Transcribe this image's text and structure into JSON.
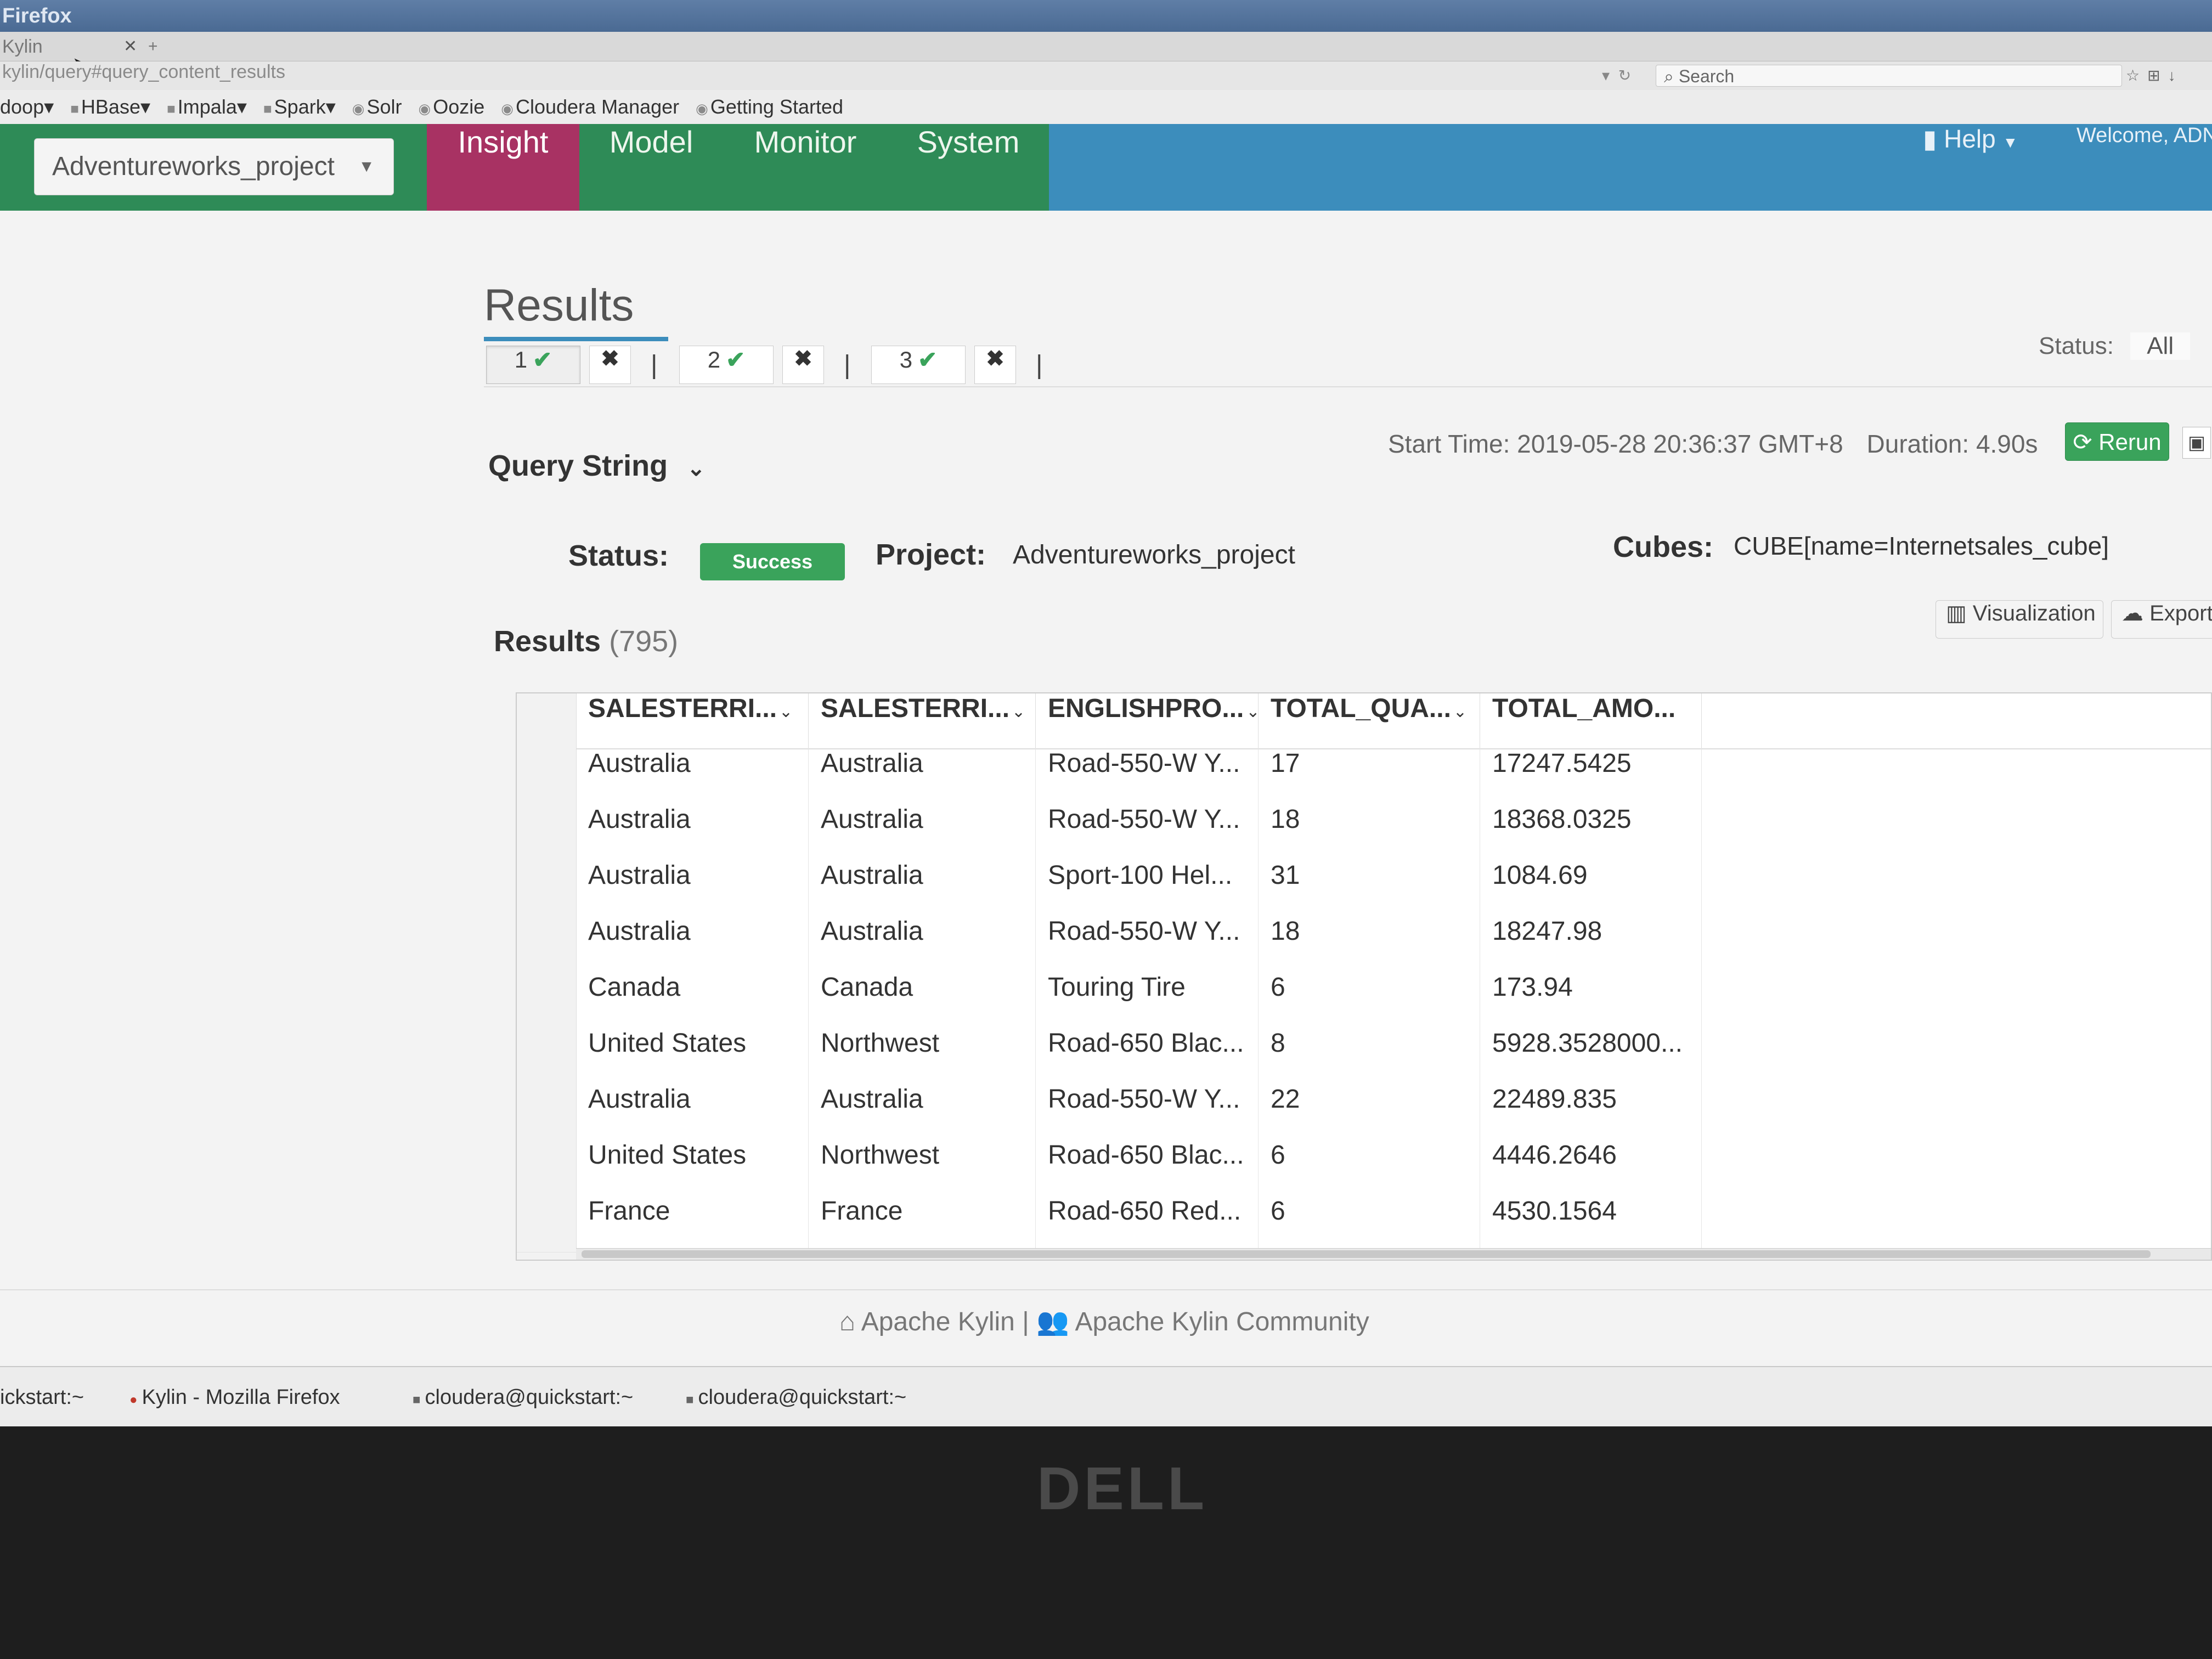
{
  "browser": {
    "window_title": "Firefox",
    "tab_title": "Kylin",
    "url": "kylin/query#query_content_results",
    "search_placeholder": "Search",
    "bookmarks": [
      "doop",
      "HBase",
      "Impala",
      "Spark",
      "Solr",
      "Oozie",
      "Cloudera Manager",
      "Getting Started"
    ]
  },
  "nav": {
    "project": "Adventureworks_project",
    "tabs": [
      "Insight",
      "Model",
      "Monitor",
      "System"
    ],
    "active_tab": "Insight",
    "help": "Help",
    "welcome": "Welcome, ADN"
  },
  "results": {
    "title": "Results",
    "query_tabs": [
      "1",
      "2",
      "3"
    ],
    "status_filter_label": "Status:",
    "status_filter_value": "All",
    "query_string_label": "Query String",
    "start_time": "Start Time: 2019-05-28 20:36:37 GMT+8",
    "duration": "Duration: 4.90s",
    "rerun": "Rerun",
    "status_label": "Status:",
    "status_value": "Success",
    "project_label": "Project:",
    "project_value": "Adventureworks_project",
    "cubes_label": "Cubes:",
    "cubes_value": "CUBE[name=Internetsales_cube]",
    "results_label": "Results",
    "results_count": "(795)",
    "visualization": "Visualization",
    "export": "Export"
  },
  "table": {
    "columns": [
      "SALESTERRI...",
      "SALESTERRI...",
      "ENGLISHPRO...",
      "TOTAL_QUA...",
      "TOTAL_AMO..."
    ],
    "rows": [
      [
        "Australia",
        "Australia",
        "Road-550-W Y...",
        "17",
        "17247.5425"
      ],
      [
        "Australia",
        "Australia",
        "Road-550-W Y...",
        "18",
        "18368.0325"
      ],
      [
        "Australia",
        "Australia",
        "Sport-100 Hel...",
        "31",
        "1084.69"
      ],
      [
        "Australia",
        "Australia",
        "Road-550-W Y...",
        "18",
        "18247.98"
      ],
      [
        "Canada",
        "Canada",
        "Touring Tire",
        "6",
        "173.94"
      ],
      [
        "United States",
        "Northwest",
        "Road-650 Blac...",
        "8",
        "5928.3528000..."
      ],
      [
        "Australia",
        "Australia",
        "Road-550-W Y...",
        "22",
        "22489.835"
      ],
      [
        "United States",
        "Northwest",
        "Road-650 Blac...",
        "6",
        "4446.2646"
      ],
      [
        "France",
        "France",
        "Road-650 Red...",
        "6",
        "4530.1564"
      ]
    ]
  },
  "footer": {
    "link1": "Apache Kylin",
    "separator": "|",
    "link2": "Apache Kylin Community"
  },
  "taskbar": {
    "items": [
      "ickstart:~",
      "Kylin - Mozilla Firefox",
      "cloudera@quickstart:~",
      "cloudera@quickstart:~"
    ]
  },
  "monitor_brand": "DELL"
}
